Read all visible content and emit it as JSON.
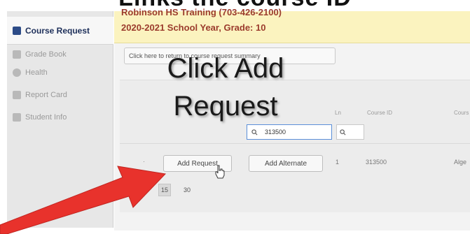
{
  "caption": "Links the course ID",
  "sidebar": {
    "items": [
      {
        "label": "Course Request",
        "active": true
      },
      {
        "label": "Grade Book"
      },
      {
        "label": "Health"
      },
      {
        "label": "Report Card"
      },
      {
        "label": "Student Info"
      }
    ]
  },
  "banner": {
    "line1": "Robinson HS Training (703-426-2100)",
    "line2": "2020-2021 School Year, Grade: 10"
  },
  "return_button": "Click here to return to course request summary",
  "overlay": {
    "line1": "Click Add",
    "line2": "Request"
  },
  "table": {
    "headers": [
      "Ln",
      "Course ID",
      "Cours"
    ],
    "course_id_value": "313500",
    "search_icon": "search-icon",
    "row": {
      "index": "1",
      "course_id": "313500",
      "course_name": "Alge"
    }
  },
  "buttons": {
    "add_request": "Add Request",
    "add_alternate": "Add Alternate"
  },
  "pagination": [
    "15",
    "30"
  ],
  "colors": {
    "banner_bg": "#fbf3bf",
    "banner_text": "#9b3b2c",
    "arrow": "#e8322c",
    "active_nav": "#1d2f5a"
  }
}
